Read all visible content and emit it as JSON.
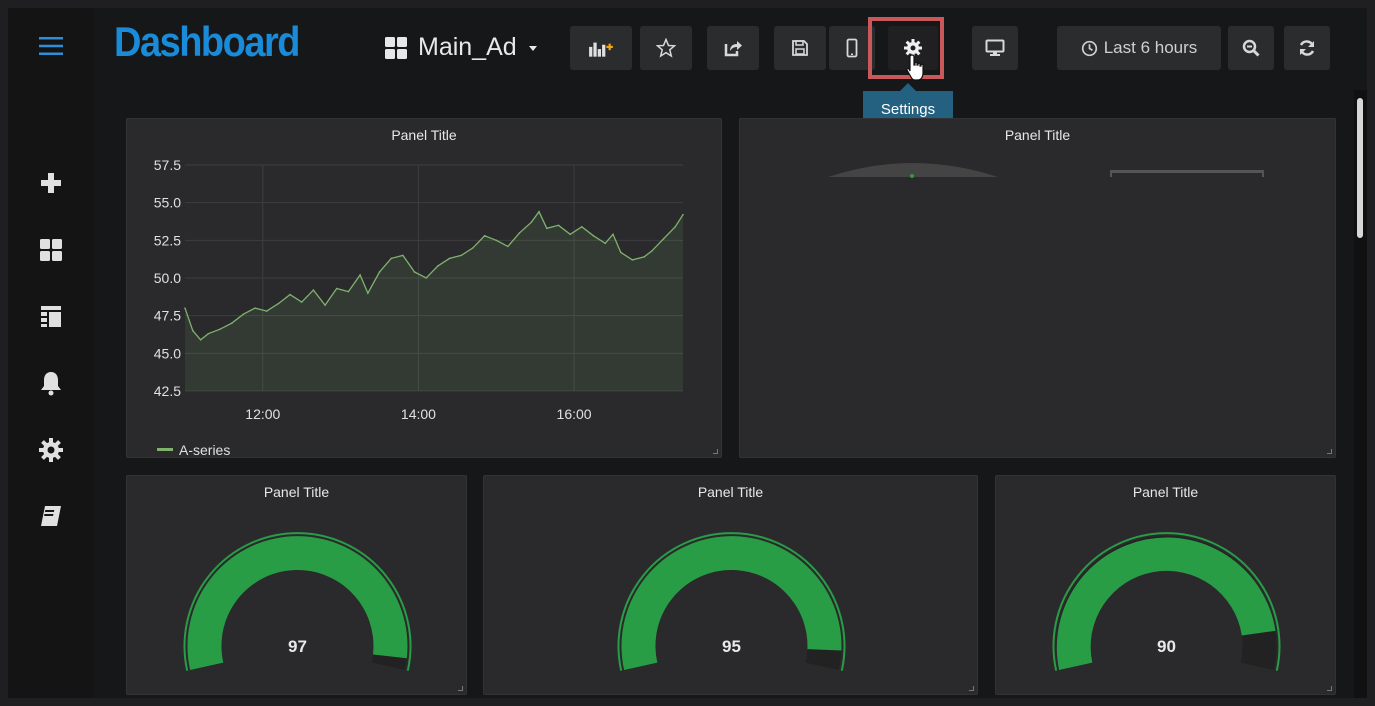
{
  "header": {
    "brand": "Dashboard",
    "dashboard_name": "Main_Ad",
    "time_range": "Last 6 hours",
    "tooltip": "Settings"
  },
  "icons": {
    "menu": "hamburger-icon",
    "add": "plus-icon",
    "dashboards": "grid-icon",
    "playlists": "table-icon",
    "alerts": "bell-icon",
    "config": "gear-icon",
    "help": "book-icon",
    "toolbar": [
      "add-panel-icon",
      "star-icon",
      "share-icon",
      "save-icon",
      "mobile-icon",
      "gear-icon",
      "monitor-icon",
      "clock-icon",
      "zoom-out-icon",
      "refresh-icon"
    ]
  },
  "colors": {
    "brand": "#1a8bd8",
    "series": "#7eb26d",
    "gauge": "#299c46",
    "tooltip": "#24607f",
    "highlight": "#c9585a"
  },
  "panels": {
    "graph": {
      "title": "Panel Title",
      "legend": "A-series"
    },
    "top_right": {
      "title": "Panel Title"
    },
    "gauge1": {
      "title": "Panel Title",
      "value": "97"
    },
    "gauge2": {
      "title": "Panel Title",
      "value": "95"
    },
    "gauge3": {
      "title": "Panel Title",
      "value": "90"
    }
  },
  "chart_data": {
    "type": "line",
    "series": [
      {
        "name": "A-series",
        "values": [
          [
            11.0,
            48.0
          ],
          [
            11.1,
            46.5
          ],
          [
            11.2,
            45.9
          ],
          [
            11.3,
            46.3
          ],
          [
            11.45,
            46.6
          ],
          [
            11.6,
            47.0
          ],
          [
            11.75,
            47.6
          ],
          [
            11.9,
            48.0
          ],
          [
            12.05,
            47.8
          ],
          [
            12.2,
            48.3
          ],
          [
            12.35,
            48.9
          ],
          [
            12.5,
            48.4
          ],
          [
            12.65,
            49.2
          ],
          [
            12.8,
            48.2
          ],
          [
            12.95,
            49.3
          ],
          [
            13.1,
            49.1
          ],
          [
            13.25,
            50.2
          ],
          [
            13.35,
            49.0
          ],
          [
            13.5,
            50.4
          ],
          [
            13.65,
            51.3
          ],
          [
            13.8,
            51.5
          ],
          [
            13.95,
            50.4
          ],
          [
            14.1,
            50.0
          ],
          [
            14.25,
            50.8
          ],
          [
            14.4,
            51.3
          ],
          [
            14.55,
            51.5
          ],
          [
            14.7,
            52.0
          ],
          [
            14.85,
            52.8
          ],
          [
            15.0,
            52.5
          ],
          [
            15.15,
            52.1
          ],
          [
            15.3,
            53.0
          ],
          [
            15.45,
            53.7
          ],
          [
            15.55,
            54.4
          ],
          [
            15.65,
            53.3
          ],
          [
            15.8,
            53.5
          ],
          [
            15.95,
            52.9
          ],
          [
            16.1,
            53.4
          ],
          [
            16.25,
            52.8
          ],
          [
            16.4,
            52.3
          ],
          [
            16.5,
            52.9
          ],
          [
            16.6,
            51.7
          ],
          [
            16.75,
            51.2
          ],
          [
            16.9,
            51.4
          ],
          [
            17.0,
            51.8
          ],
          [
            17.15,
            52.6
          ],
          [
            17.3,
            53.4
          ],
          [
            17.4,
            54.2
          ]
        ]
      }
    ],
    "xticks": [
      "12:00",
      "14:00",
      "16:00"
    ],
    "xtick_values": [
      12,
      14,
      16
    ],
    "ylim": [
      42.5,
      57.5
    ],
    "yticks": [
      "42.5",
      "45.0",
      "47.5",
      "50.0",
      "52.5",
      "55.0",
      "57.5"
    ],
    "grid": true,
    "legend_position": "bottom-left"
  }
}
